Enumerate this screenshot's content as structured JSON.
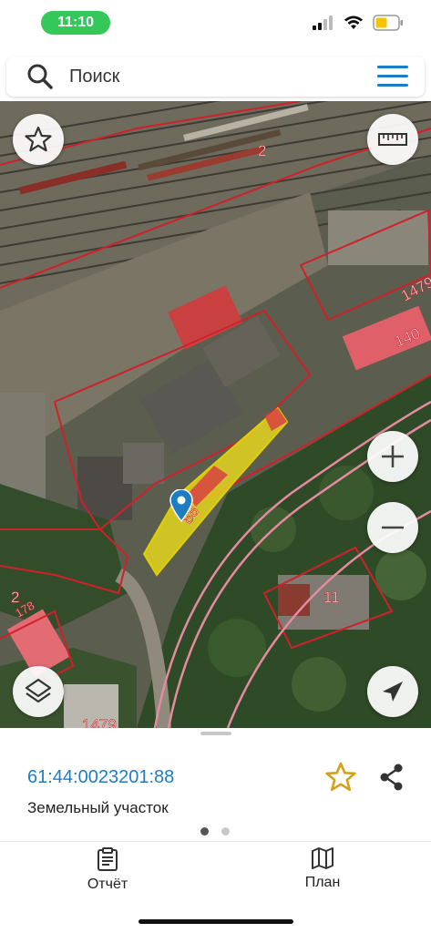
{
  "status_bar": {
    "time": "11:10"
  },
  "search": {
    "placeholder": "Поиск"
  },
  "map": {
    "labels": [
      "2",
      "1479",
      "140",
      "88",
      "11",
      "2",
      "178",
      "1479"
    ]
  },
  "details": {
    "cadastral_number": "61:44:0023201:88",
    "object_type": "Земельный участок"
  },
  "pager": {
    "pages": 2,
    "active": 1
  },
  "tabs": [
    {
      "label": "Отчёт",
      "icon": "clipboard-icon"
    },
    {
      "label": "План",
      "icon": "map-icon"
    }
  ],
  "colors": {
    "accent": "#1d7dc3",
    "boundary": "#d0202a",
    "selected_parcel": "#f5e619",
    "status_green": "#34c759",
    "favorite": "#d4a017"
  }
}
